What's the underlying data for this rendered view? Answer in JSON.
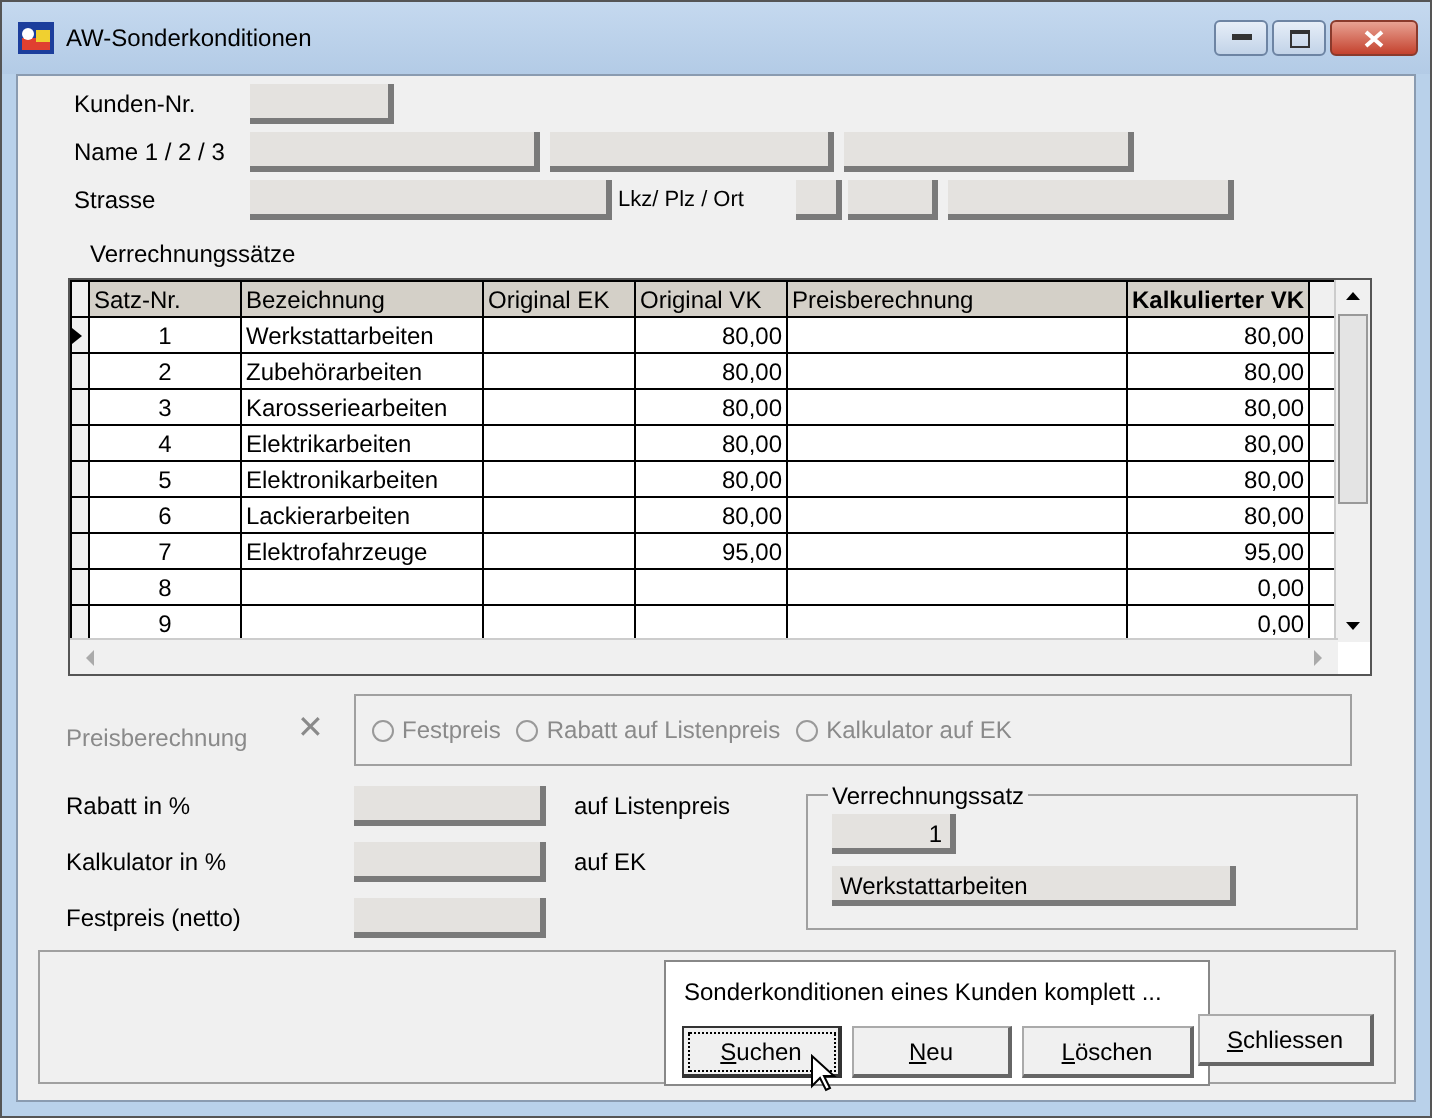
{
  "window": {
    "title": "AW-Sonderkonditionen"
  },
  "customer": {
    "labels": [
      "Kunden-Nr.",
      "Name 1 / 2 / 3",
      "Strasse",
      "Lkz/ Plz / Ort"
    ]
  },
  "table": {
    "title": "Verrechnungssätze",
    "columns": [
      "Satz-Nr.",
      "Bezeichnung",
      "Original EK",
      "Original VK",
      "Preisberechnung",
      "Kalkulierter VK"
    ],
    "rows": [
      {
        "cells": [
          "1",
          "Werkstattarbeiten",
          "",
          "80,00",
          "",
          "80,00"
        ],
        "selected": true
      },
      {
        "cells": [
          "2",
          "Zubehörarbeiten",
          "",
          "80,00",
          "",
          "80,00"
        ],
        "selected": false
      },
      {
        "cells": [
          "3",
          "Karosseriearbeiten",
          "",
          "80,00",
          "",
          "80,00"
        ],
        "selected": false
      },
      {
        "cells": [
          "4",
          "Elektrikarbeiten",
          "",
          "80,00",
          "",
          "80,00"
        ],
        "selected": false
      },
      {
        "cells": [
          "5",
          "Elektronikarbeiten",
          "",
          "80,00",
          "",
          "80,00"
        ],
        "selected": false
      },
      {
        "cells": [
          "6",
          "Lackierarbeiten",
          "",
          "80,00",
          "",
          "80,00"
        ],
        "selected": false
      },
      {
        "cells": [
          "7",
          "Elektrofahrzeuge",
          "",
          "95,00",
          "",
          "95,00"
        ],
        "selected": false
      },
      {
        "cells": [
          "8",
          "",
          "",
          "",
          "",
          "0,00"
        ],
        "selected": false
      },
      {
        "cells": [
          "9",
          "",
          "",
          "",
          "",
          "0,00"
        ],
        "selected": false
      }
    ]
  },
  "pricing": {
    "label": "Preisberechnung",
    "clear": "✕",
    "disabled": true,
    "options": [
      {
        "label": "Festpreis",
        "selected": false
      },
      {
        "label": "Rabatt auf Listenpreis",
        "selected": false
      },
      {
        "label": "Kalkulator auf EK",
        "selected": false
      }
    ]
  },
  "inputs": [
    {
      "label": "Rabatt in %",
      "suffix": "auf Listenpreis"
    },
    {
      "label": "Kalkulator in %",
      "suffix": "auf EK"
    },
    {
      "label": "Festpreis (netto)"
    }
  ],
  "rate": {
    "title": "Verrechnungssatz",
    "number": "1",
    "name": "Werkstattarbeiten"
  },
  "actions": {
    "title": "Sonderkonditionen eines Kunden komplett ...",
    "buttons": [
      {
        "label": "Suchen",
        "focused": true
      },
      {
        "label": "Neu",
        "focused": false
      },
      {
        "label": "Löschen",
        "focused": false
      }
    ]
  },
  "close_button": "Schliessen"
}
